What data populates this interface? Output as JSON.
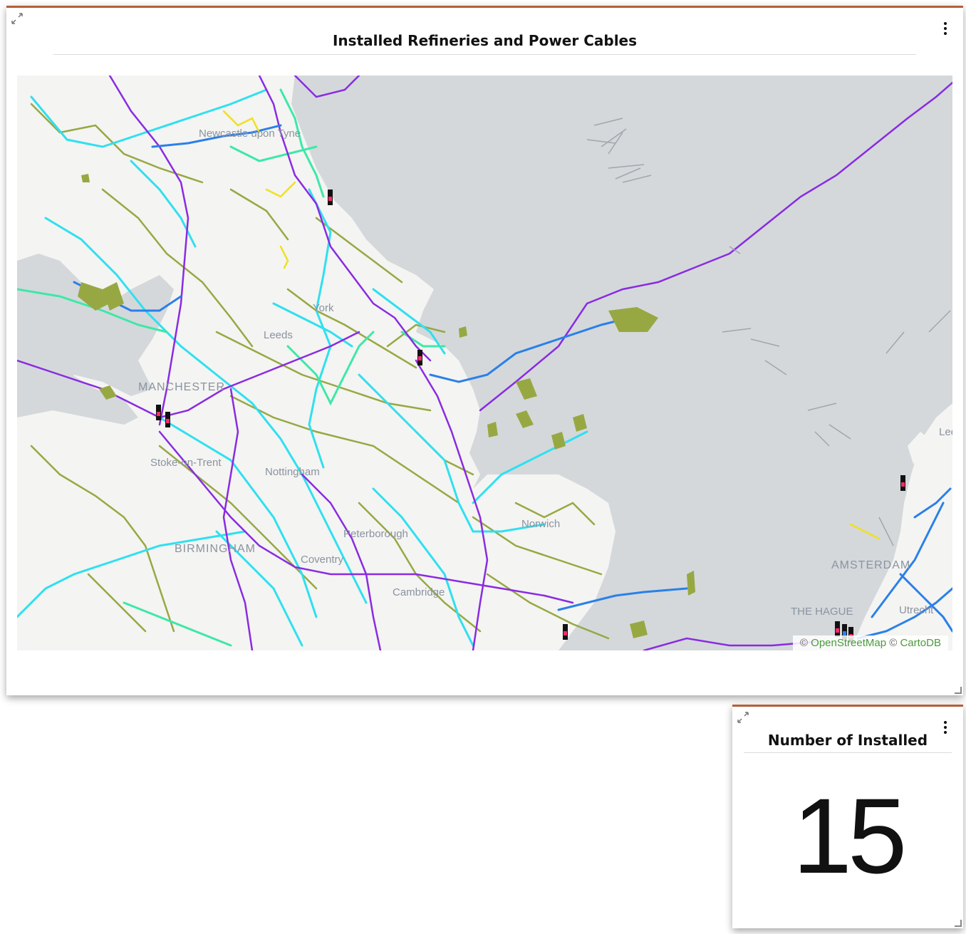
{
  "map_panel": {
    "title": "Installed Refineries and Power Cables",
    "map": {
      "city_labels": {
        "newcastle": "Newcastle upon Tyne",
        "york": "York",
        "leeds": "Leeds",
        "manchester": "MANCHESTER",
        "stoke": "Stoke-on-Trent",
        "nottingham": "Nottingham",
        "birmingham": "BIRMINGHAM",
        "peterborough": "Peterborough",
        "coventry": "Coventry",
        "cambridge": "Cambridge",
        "norwich": "Norwich",
        "amsterdam": "AMSTERDAM",
        "the_hague": "THE HAGUE",
        "utrecht": "Utrecht",
        "leeuwarden": "Lee"
      },
      "attribution": {
        "prefix": "©",
        "osm": "OpenStreetMap",
        "separator": "©",
        "carto": "CartoDB"
      },
      "colors": {
        "sea": "#d4d8db",
        "land": "#f4f4f2",
        "cable_cyan": "#2fe0f0",
        "cable_olive": "#97a843",
        "cable_purple": "#8a2be2",
        "cable_blue": "#2a80e8",
        "cable_green": "#3de8a8",
        "cable_yellow": "#f0e020",
        "refinery": "#111111",
        "refinery_highlight": "#ff2a6a"
      }
    }
  },
  "count_panel": {
    "title": "Number of Installed",
    "value": "15"
  },
  "colors": {
    "panel_accent": "#b3603a"
  }
}
